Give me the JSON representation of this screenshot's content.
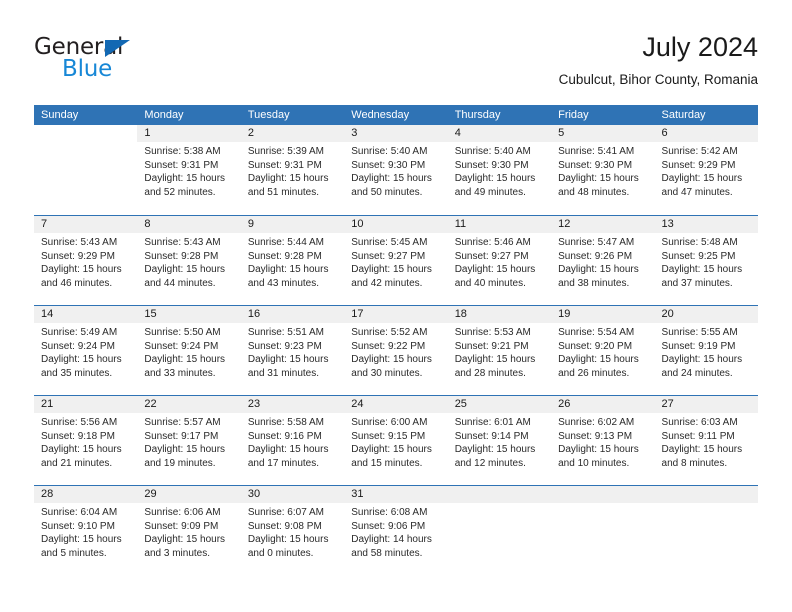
{
  "brand": {
    "name_dark": "General",
    "name_blue": "Blue",
    "accent_color": "#1268b3",
    "blue_text_color": "#1787d6"
  },
  "header": {
    "title": "July 2024",
    "subtitle": "Cubulcut, Bihor County, Romania"
  },
  "theme": {
    "header_bar_color": "#2f73b5",
    "row_divider_color": "#2f73b5",
    "day_band_color": "#f0f0f0"
  },
  "weekdays": [
    "Sunday",
    "Monday",
    "Tuesday",
    "Wednesday",
    "Thursday",
    "Friday",
    "Saturday"
  ],
  "weeks": [
    [
      {
        "day": "",
        "sunrise": "",
        "sunset": "",
        "daylight_line1": "",
        "daylight_line2": ""
      },
      {
        "day": "1",
        "sunrise": "Sunrise: 5:38 AM",
        "sunset": "Sunset: 9:31 PM",
        "daylight_line1": "Daylight: 15 hours",
        "daylight_line2": "and 52 minutes."
      },
      {
        "day": "2",
        "sunrise": "Sunrise: 5:39 AM",
        "sunset": "Sunset: 9:31 PM",
        "daylight_line1": "Daylight: 15 hours",
        "daylight_line2": "and 51 minutes."
      },
      {
        "day": "3",
        "sunrise": "Sunrise: 5:40 AM",
        "sunset": "Sunset: 9:30 PM",
        "daylight_line1": "Daylight: 15 hours",
        "daylight_line2": "and 50 minutes."
      },
      {
        "day": "4",
        "sunrise": "Sunrise: 5:40 AM",
        "sunset": "Sunset: 9:30 PM",
        "daylight_line1": "Daylight: 15 hours",
        "daylight_line2": "and 49 minutes."
      },
      {
        "day": "5",
        "sunrise": "Sunrise: 5:41 AM",
        "sunset": "Sunset: 9:30 PM",
        "daylight_line1": "Daylight: 15 hours",
        "daylight_line2": "and 48 minutes."
      },
      {
        "day": "6",
        "sunrise": "Sunrise: 5:42 AM",
        "sunset": "Sunset: 9:29 PM",
        "daylight_line1": "Daylight: 15 hours",
        "daylight_line2": "and 47 minutes."
      }
    ],
    [
      {
        "day": "7",
        "sunrise": "Sunrise: 5:43 AM",
        "sunset": "Sunset: 9:29 PM",
        "daylight_line1": "Daylight: 15 hours",
        "daylight_line2": "and 46 minutes."
      },
      {
        "day": "8",
        "sunrise": "Sunrise: 5:43 AM",
        "sunset": "Sunset: 9:28 PM",
        "daylight_line1": "Daylight: 15 hours",
        "daylight_line2": "and 44 minutes."
      },
      {
        "day": "9",
        "sunrise": "Sunrise: 5:44 AM",
        "sunset": "Sunset: 9:28 PM",
        "daylight_line1": "Daylight: 15 hours",
        "daylight_line2": "and 43 minutes."
      },
      {
        "day": "10",
        "sunrise": "Sunrise: 5:45 AM",
        "sunset": "Sunset: 9:27 PM",
        "daylight_line1": "Daylight: 15 hours",
        "daylight_line2": "and 42 minutes."
      },
      {
        "day": "11",
        "sunrise": "Sunrise: 5:46 AM",
        "sunset": "Sunset: 9:27 PM",
        "daylight_line1": "Daylight: 15 hours",
        "daylight_line2": "and 40 minutes."
      },
      {
        "day": "12",
        "sunrise": "Sunrise: 5:47 AM",
        "sunset": "Sunset: 9:26 PM",
        "daylight_line1": "Daylight: 15 hours",
        "daylight_line2": "and 38 minutes."
      },
      {
        "day": "13",
        "sunrise": "Sunrise: 5:48 AM",
        "sunset": "Sunset: 9:25 PM",
        "daylight_line1": "Daylight: 15 hours",
        "daylight_line2": "and 37 minutes."
      }
    ],
    [
      {
        "day": "14",
        "sunrise": "Sunrise: 5:49 AM",
        "sunset": "Sunset: 9:24 PM",
        "daylight_line1": "Daylight: 15 hours",
        "daylight_line2": "and 35 minutes."
      },
      {
        "day": "15",
        "sunrise": "Sunrise: 5:50 AM",
        "sunset": "Sunset: 9:24 PM",
        "daylight_line1": "Daylight: 15 hours",
        "daylight_line2": "and 33 minutes."
      },
      {
        "day": "16",
        "sunrise": "Sunrise: 5:51 AM",
        "sunset": "Sunset: 9:23 PM",
        "daylight_line1": "Daylight: 15 hours",
        "daylight_line2": "and 31 minutes."
      },
      {
        "day": "17",
        "sunrise": "Sunrise: 5:52 AM",
        "sunset": "Sunset: 9:22 PM",
        "daylight_line1": "Daylight: 15 hours",
        "daylight_line2": "and 30 minutes."
      },
      {
        "day": "18",
        "sunrise": "Sunrise: 5:53 AM",
        "sunset": "Sunset: 9:21 PM",
        "daylight_line1": "Daylight: 15 hours",
        "daylight_line2": "and 28 minutes."
      },
      {
        "day": "19",
        "sunrise": "Sunrise: 5:54 AM",
        "sunset": "Sunset: 9:20 PM",
        "daylight_line1": "Daylight: 15 hours",
        "daylight_line2": "and 26 minutes."
      },
      {
        "day": "20",
        "sunrise": "Sunrise: 5:55 AM",
        "sunset": "Sunset: 9:19 PM",
        "daylight_line1": "Daylight: 15 hours",
        "daylight_line2": "and 24 minutes."
      }
    ],
    [
      {
        "day": "21",
        "sunrise": "Sunrise: 5:56 AM",
        "sunset": "Sunset: 9:18 PM",
        "daylight_line1": "Daylight: 15 hours",
        "daylight_line2": "and 21 minutes."
      },
      {
        "day": "22",
        "sunrise": "Sunrise: 5:57 AM",
        "sunset": "Sunset: 9:17 PM",
        "daylight_line1": "Daylight: 15 hours",
        "daylight_line2": "and 19 minutes."
      },
      {
        "day": "23",
        "sunrise": "Sunrise: 5:58 AM",
        "sunset": "Sunset: 9:16 PM",
        "daylight_line1": "Daylight: 15 hours",
        "daylight_line2": "and 17 minutes."
      },
      {
        "day": "24",
        "sunrise": "Sunrise: 6:00 AM",
        "sunset": "Sunset: 9:15 PM",
        "daylight_line1": "Daylight: 15 hours",
        "daylight_line2": "and 15 minutes."
      },
      {
        "day": "25",
        "sunrise": "Sunrise: 6:01 AM",
        "sunset": "Sunset: 9:14 PM",
        "daylight_line1": "Daylight: 15 hours",
        "daylight_line2": "and 12 minutes."
      },
      {
        "day": "26",
        "sunrise": "Sunrise: 6:02 AM",
        "sunset": "Sunset: 9:13 PM",
        "daylight_line1": "Daylight: 15 hours",
        "daylight_line2": "and 10 minutes."
      },
      {
        "day": "27",
        "sunrise": "Sunrise: 6:03 AM",
        "sunset": "Sunset: 9:11 PM",
        "daylight_line1": "Daylight: 15 hours",
        "daylight_line2": "and 8 minutes."
      }
    ],
    [
      {
        "day": "28",
        "sunrise": "Sunrise: 6:04 AM",
        "sunset": "Sunset: 9:10 PM",
        "daylight_line1": "Daylight: 15 hours",
        "daylight_line2": "and 5 minutes."
      },
      {
        "day": "29",
        "sunrise": "Sunrise: 6:06 AM",
        "sunset": "Sunset: 9:09 PM",
        "daylight_line1": "Daylight: 15 hours",
        "daylight_line2": "and 3 minutes."
      },
      {
        "day": "30",
        "sunrise": "Sunrise: 6:07 AM",
        "sunset": "Sunset: 9:08 PM",
        "daylight_line1": "Daylight: 15 hours",
        "daylight_line2": "and 0 minutes."
      },
      {
        "day": "31",
        "sunrise": "Sunrise: 6:08 AM",
        "sunset": "Sunset: 9:06 PM",
        "daylight_line1": "Daylight: 14 hours",
        "daylight_line2": "and 58 minutes."
      },
      {
        "day": "",
        "sunrise": "",
        "sunset": "",
        "daylight_line1": "",
        "daylight_line2": ""
      },
      {
        "day": "",
        "sunrise": "",
        "sunset": "",
        "daylight_line1": "",
        "daylight_line2": ""
      },
      {
        "day": "",
        "sunrise": "",
        "sunset": "",
        "daylight_line1": "",
        "daylight_line2": ""
      }
    ]
  ]
}
